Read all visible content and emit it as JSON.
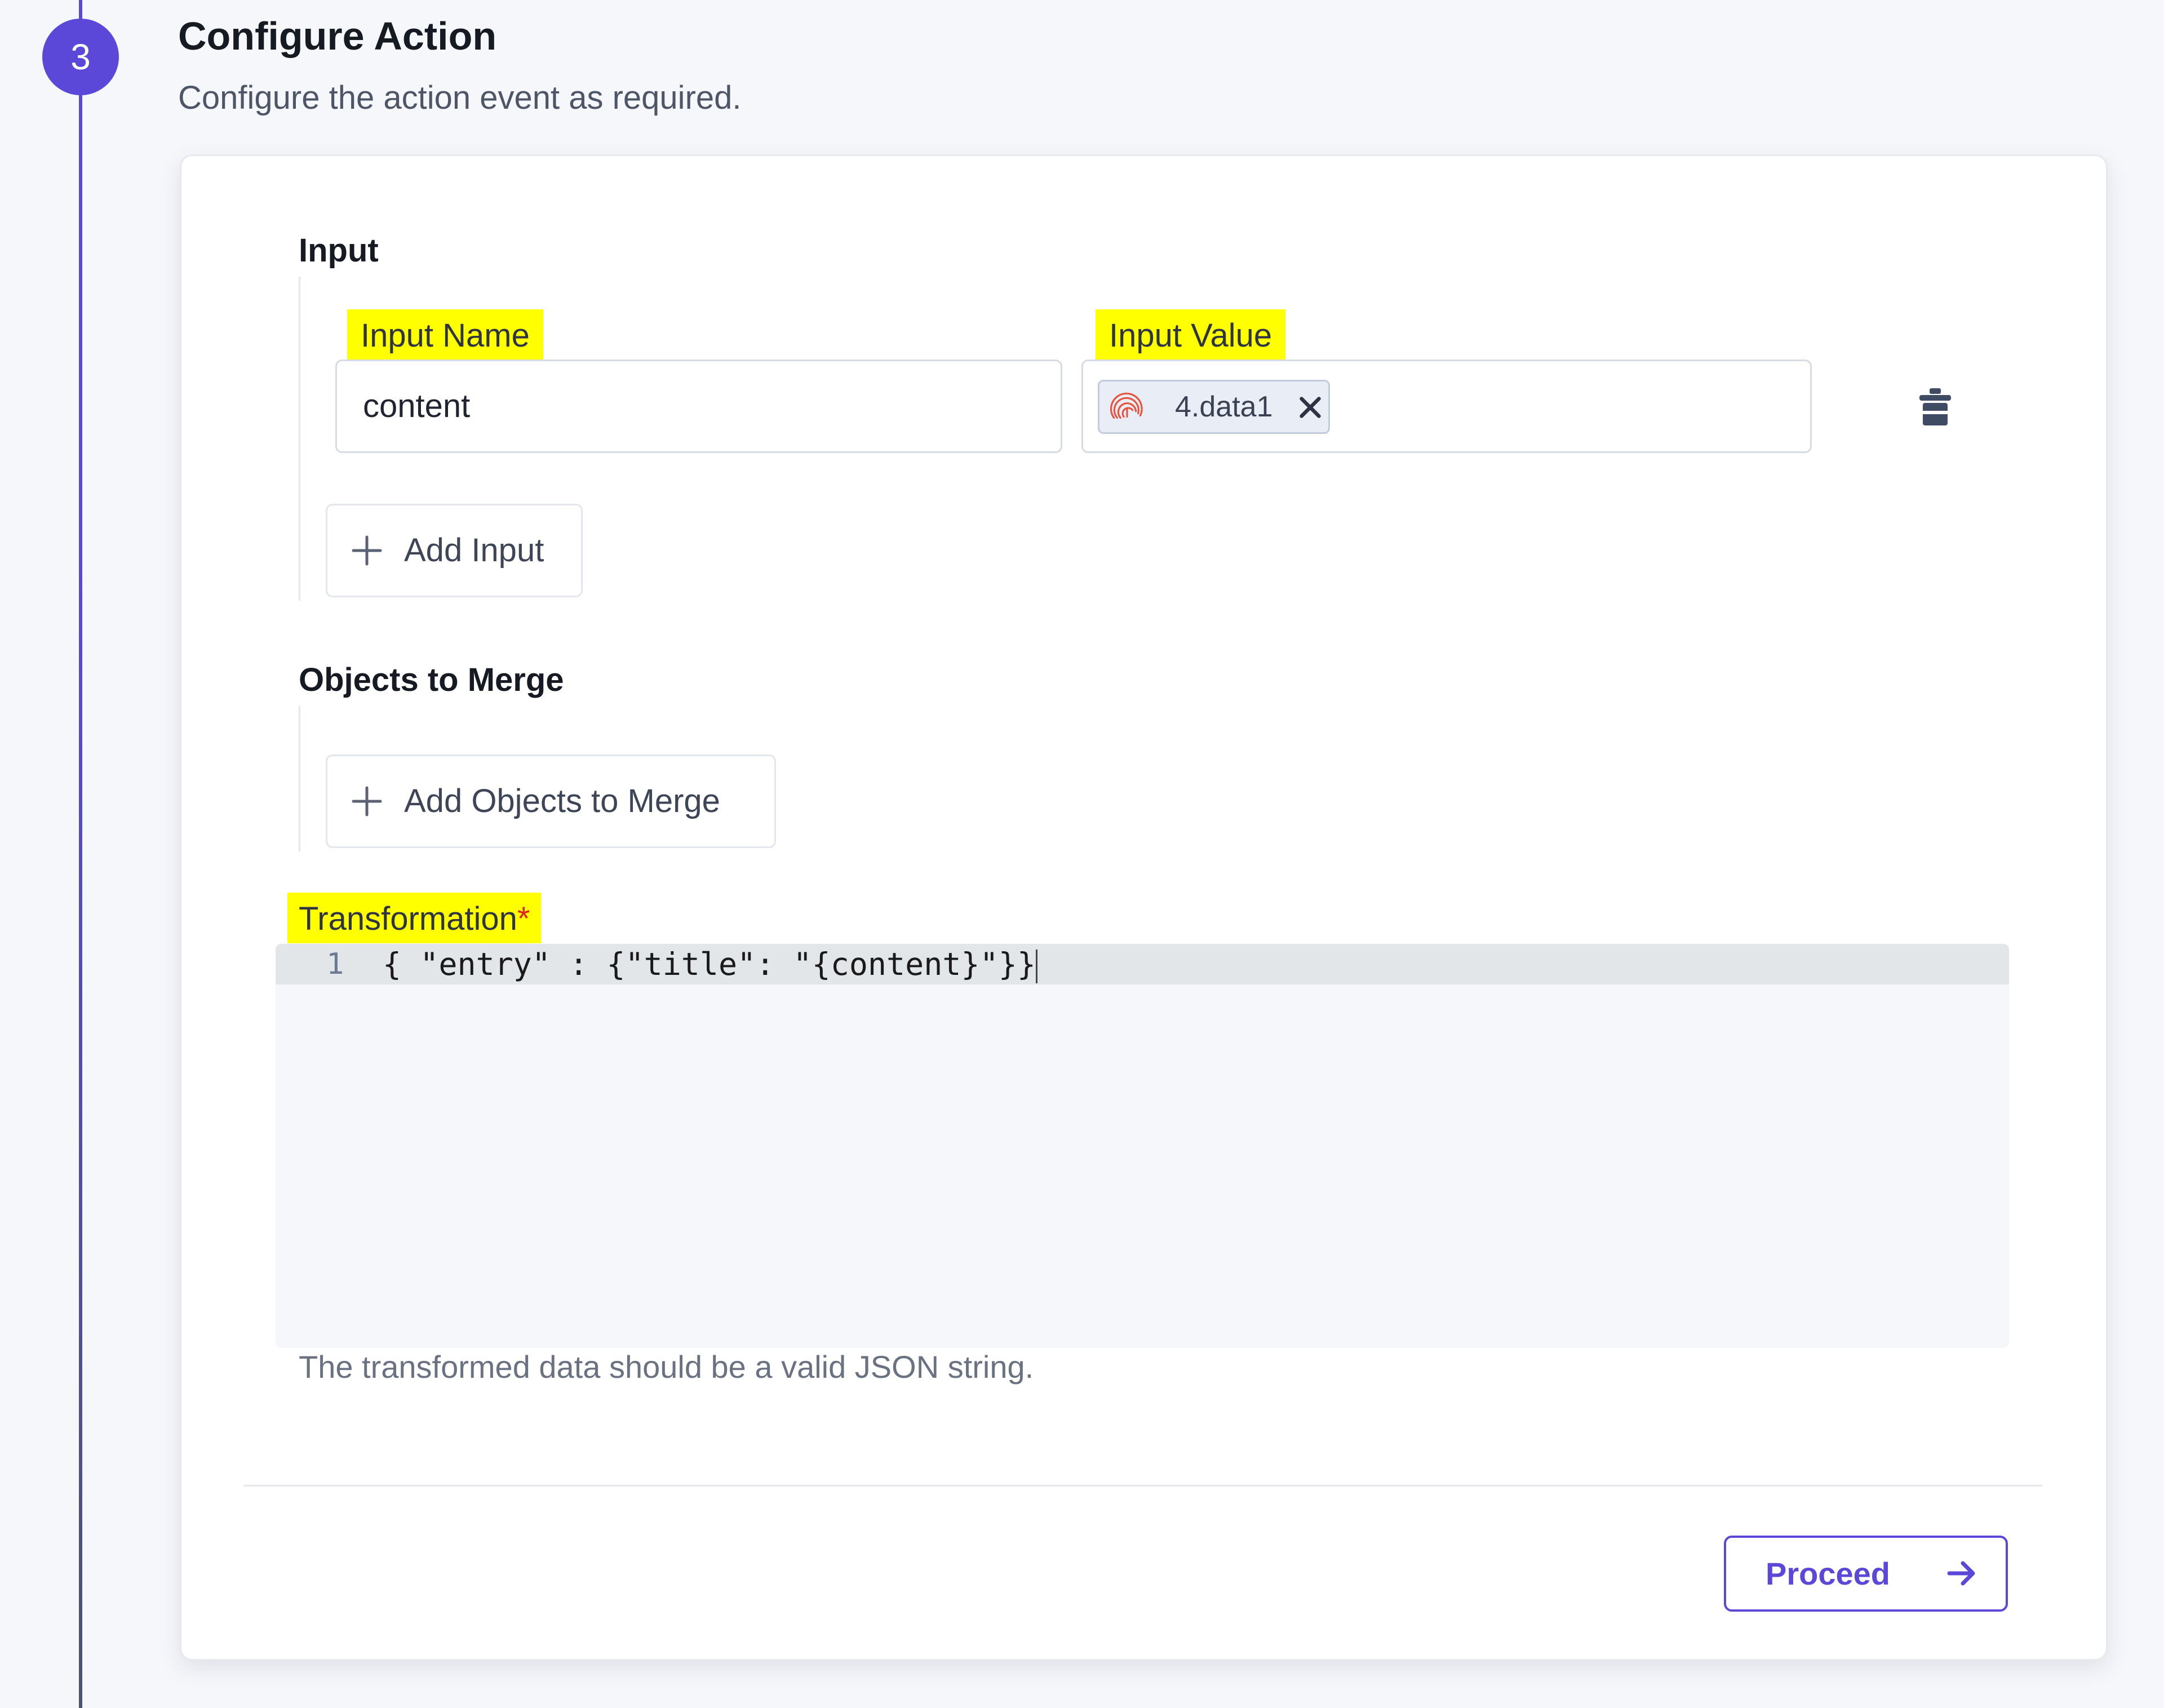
{
  "step": {
    "number": "3",
    "title": "Configure Action",
    "description": "Configure the action event as required."
  },
  "input_section": {
    "label": "Input",
    "name_label": "Input Name",
    "value_label": "Input Value",
    "rows": [
      {
        "name": "content",
        "value_chip": {
          "label": "4.data1",
          "icon": "fingerprint-icon",
          "icon_color": "#e8523e"
        }
      }
    ],
    "add_button_label": "Add Input"
  },
  "merge_section": {
    "label": "Objects to Merge",
    "add_button_label": "Add Objects to Merge"
  },
  "transformation": {
    "label": "Transformation",
    "required_marker": "*",
    "line_number": "1",
    "code": "{ \"entry\" : {\"title\": \"{content}\"}}",
    "hint": "The transformed data should be a valid JSON string."
  },
  "footer": {
    "proceed_label": "Proceed"
  },
  "colors": {
    "accent": "#5b48d9",
    "highlight": "#ffff00",
    "required": "#e02424"
  }
}
